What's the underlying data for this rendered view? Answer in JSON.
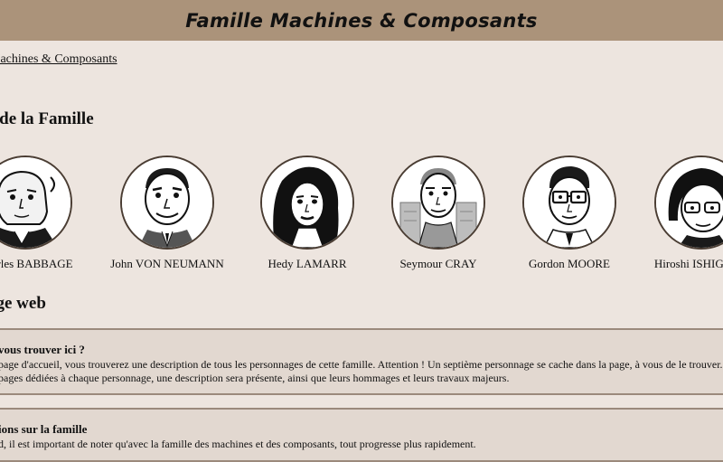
{
  "header": {
    "title": "Famille Machines & Composants"
  },
  "breadcrumb": {
    "label": "Machines & Composants"
  },
  "members_section": {
    "title": "s de la Famille",
    "members": [
      {
        "name": "Charles BABBAGE",
        "icon": "portrait-babbage"
      },
      {
        "name": "John VON NEUMANN",
        "icon": "portrait-von-neumann"
      },
      {
        "name": "Hedy LAMARR",
        "icon": "portrait-lamarr"
      },
      {
        "name": "Seymour CRAY",
        "icon": "portrait-cray"
      },
      {
        "name": "Gordon MOORE",
        "icon": "portrait-moore"
      },
      {
        "name": "Hiroshi ISHIGURO",
        "icon": "portrait-ishiguro"
      }
    ]
  },
  "website_section": {
    "title": "age web",
    "panels": [
      {
        "title": "vous trouver ici ?",
        "lines": [
          "page d'accueil, vous trouverez une description de tous les personnages de cette famille. Attention ! Un septième personnage se cache dans la page, à vous de le trouver.",
          "pages dédiées à chaque personnage, une description sera présente, ainsi que leurs hommages et leurs travaux majeurs."
        ]
      },
      {
        "title": "ions sur la famille",
        "lines": [
          "d, il est important de noter qu'avec la famille des machines et des composants, tout progresse plus rapidement."
        ]
      }
    ]
  },
  "colors": {
    "header_bg": "#ab937a",
    "page_bg": "#ede5df",
    "panel_bg": "#e2d8d0",
    "portrait_border": "#4a3d33"
  }
}
